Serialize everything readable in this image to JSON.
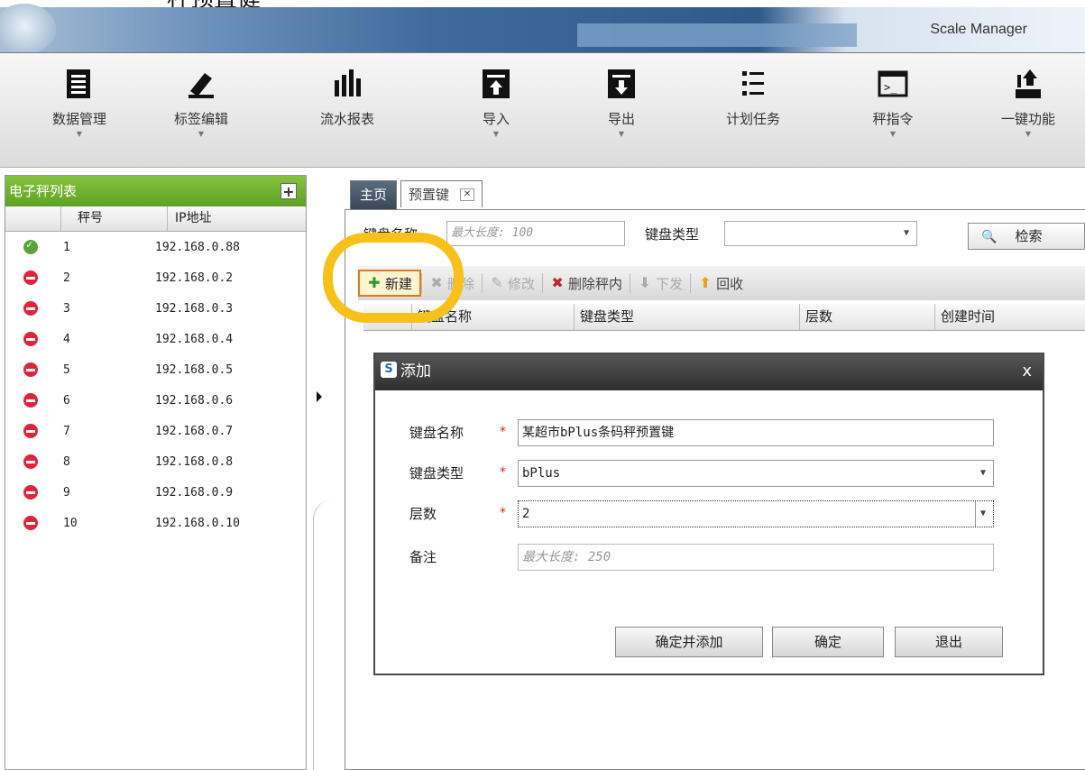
{
  "window": {
    "caption_partial": "秤预置健",
    "app_name": "Scale Manager"
  },
  "toolbar": [
    {
      "label": "数据管理",
      "icon": "data-management-icon",
      "dropdown": true
    },
    {
      "label": "标签编辑",
      "icon": "label-edit-icon",
      "dropdown": true
    },
    {
      "label": "流水报表",
      "icon": "report-icon",
      "dropdown": false
    },
    {
      "label": "导入",
      "icon": "import-icon",
      "dropdown": true
    },
    {
      "label": "导出",
      "icon": "export-icon",
      "dropdown": true
    },
    {
      "label": "计划任务",
      "icon": "scheduled-task-icon",
      "dropdown": false
    },
    {
      "label": "秤指令",
      "icon": "scale-command-icon",
      "dropdown": true
    },
    {
      "label": "一键功能",
      "icon": "one-key-icon",
      "dropdown": true
    }
  ],
  "sidebar": {
    "title": "电子秤列表",
    "col_no": "秤号",
    "col_ip": "IP地址",
    "rows": [
      {
        "no": "1",
        "ip": "192.168.0.88",
        "online": true
      },
      {
        "no": "2",
        "ip": "192.168.0.2",
        "online": false
      },
      {
        "no": "3",
        "ip": "192.168.0.3",
        "online": false
      },
      {
        "no": "4",
        "ip": "192.168.0.4",
        "online": false
      },
      {
        "no": "5",
        "ip": "192.168.0.5",
        "online": false
      },
      {
        "no": "6",
        "ip": "192.168.0.6",
        "online": false
      },
      {
        "no": "7",
        "ip": "192.168.0.7",
        "online": false
      },
      {
        "no": "8",
        "ip": "192.168.0.8",
        "online": false
      },
      {
        "no": "9",
        "ip": "192.168.0.9",
        "online": false
      },
      {
        "no": "10",
        "ip": "192.168.0.10",
        "online": false
      }
    ]
  },
  "tabs": {
    "home": "主页",
    "active": "预置键"
  },
  "search": {
    "name_label": "键盘名称",
    "name_placeholder": "最大长度: 100",
    "type_label": "键盘类型",
    "type_value": "",
    "button": "检索"
  },
  "actions": {
    "new": "新建",
    "delete": "删除",
    "edit": "修改",
    "delete_in_scale": "删除秤内",
    "send": "下发",
    "recall": "回收"
  },
  "grid": {
    "columns": [
      "键盘名称",
      "键盘类型",
      "层数",
      "创建时间"
    ]
  },
  "dialog": {
    "title": "添加",
    "close": "x",
    "name_label": "键盘名称",
    "name_value": "某超市bPlus条码秤预置键",
    "type_label": "键盘类型",
    "type_value": "bPlus",
    "layers_label": "层数",
    "layers_value": "2",
    "note_label": "备注",
    "note_placeholder": "最大长度: 250",
    "required_mark": "*",
    "btn_add_more": "确定并添加",
    "btn_ok": "确定",
    "btn_exit": "退出"
  }
}
